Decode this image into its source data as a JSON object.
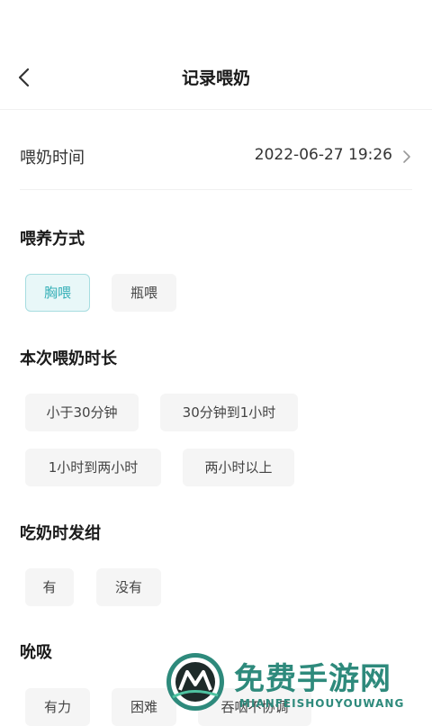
{
  "header": {
    "title": "记录喂奶"
  },
  "feed_time": {
    "label": "喂奶时间",
    "value": "2022-06-27 19:26"
  },
  "feeding_method": {
    "title": "喂养方式",
    "options": [
      {
        "label": "胸喂",
        "selected": true
      },
      {
        "label": "瓶喂",
        "selected": false
      }
    ]
  },
  "duration": {
    "title": "本次喂奶时长",
    "options": [
      {
        "label": "小于30分钟"
      },
      {
        "label": "30分钟到1小时"
      },
      {
        "label": "1小时到两小时"
      },
      {
        "label": "两小时以上"
      }
    ]
  },
  "cyanosis": {
    "title": "吃奶时发绀",
    "options": [
      {
        "label": "有"
      },
      {
        "label": "没有"
      }
    ]
  },
  "suck": {
    "title": "吮吸",
    "options": [
      {
        "label": "有力"
      },
      {
        "label": "困难"
      },
      {
        "label": "吞咽不协调"
      }
    ]
  },
  "watermark": {
    "main": "免费手游网",
    "sub": "MIANFEISHOUYOUWANG"
  },
  "colors": {
    "accent": "#37b0b8",
    "accent_bg": "#e8f7f8",
    "chip_bg": "#f5f5f5",
    "watermark": "#2e8a7c"
  }
}
